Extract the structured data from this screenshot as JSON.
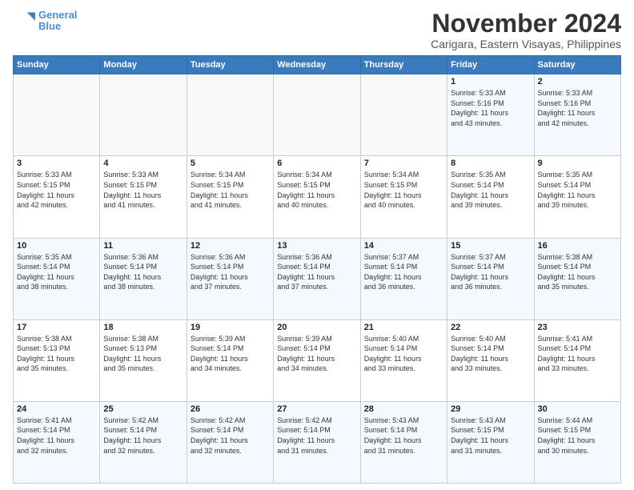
{
  "logo": {
    "line1": "General",
    "line2": "Blue"
  },
  "title": "November 2024",
  "location": "Carigara, Eastern Visayas, Philippines",
  "headers": [
    "Sunday",
    "Monday",
    "Tuesday",
    "Wednesday",
    "Thursday",
    "Friday",
    "Saturday"
  ],
  "weeks": [
    [
      {
        "day": "",
        "info": ""
      },
      {
        "day": "",
        "info": ""
      },
      {
        "day": "",
        "info": ""
      },
      {
        "day": "",
        "info": ""
      },
      {
        "day": "",
        "info": ""
      },
      {
        "day": "1",
        "info": "Sunrise: 5:33 AM\nSunset: 5:16 PM\nDaylight: 11 hours\nand 43 minutes."
      },
      {
        "day": "2",
        "info": "Sunrise: 5:33 AM\nSunset: 5:16 PM\nDaylight: 11 hours\nand 42 minutes."
      }
    ],
    [
      {
        "day": "3",
        "info": "Sunrise: 5:33 AM\nSunset: 5:15 PM\nDaylight: 11 hours\nand 42 minutes."
      },
      {
        "day": "4",
        "info": "Sunrise: 5:33 AM\nSunset: 5:15 PM\nDaylight: 11 hours\nand 41 minutes."
      },
      {
        "day": "5",
        "info": "Sunrise: 5:34 AM\nSunset: 5:15 PM\nDaylight: 11 hours\nand 41 minutes."
      },
      {
        "day": "6",
        "info": "Sunrise: 5:34 AM\nSunset: 5:15 PM\nDaylight: 11 hours\nand 40 minutes."
      },
      {
        "day": "7",
        "info": "Sunrise: 5:34 AM\nSunset: 5:15 PM\nDaylight: 11 hours\nand 40 minutes."
      },
      {
        "day": "8",
        "info": "Sunrise: 5:35 AM\nSunset: 5:14 PM\nDaylight: 11 hours\nand 39 minutes."
      },
      {
        "day": "9",
        "info": "Sunrise: 5:35 AM\nSunset: 5:14 PM\nDaylight: 11 hours\nand 39 minutes."
      }
    ],
    [
      {
        "day": "10",
        "info": "Sunrise: 5:35 AM\nSunset: 5:14 PM\nDaylight: 11 hours\nand 38 minutes."
      },
      {
        "day": "11",
        "info": "Sunrise: 5:36 AM\nSunset: 5:14 PM\nDaylight: 11 hours\nand 38 minutes."
      },
      {
        "day": "12",
        "info": "Sunrise: 5:36 AM\nSunset: 5:14 PM\nDaylight: 11 hours\nand 37 minutes."
      },
      {
        "day": "13",
        "info": "Sunrise: 5:36 AM\nSunset: 5:14 PM\nDaylight: 11 hours\nand 37 minutes."
      },
      {
        "day": "14",
        "info": "Sunrise: 5:37 AM\nSunset: 5:14 PM\nDaylight: 11 hours\nand 36 minutes."
      },
      {
        "day": "15",
        "info": "Sunrise: 5:37 AM\nSunset: 5:14 PM\nDaylight: 11 hours\nand 36 minutes."
      },
      {
        "day": "16",
        "info": "Sunrise: 5:38 AM\nSunset: 5:14 PM\nDaylight: 11 hours\nand 35 minutes."
      }
    ],
    [
      {
        "day": "17",
        "info": "Sunrise: 5:38 AM\nSunset: 5:13 PM\nDaylight: 11 hours\nand 35 minutes."
      },
      {
        "day": "18",
        "info": "Sunrise: 5:38 AM\nSunset: 5:13 PM\nDaylight: 11 hours\nand 35 minutes."
      },
      {
        "day": "19",
        "info": "Sunrise: 5:39 AM\nSunset: 5:14 PM\nDaylight: 11 hours\nand 34 minutes."
      },
      {
        "day": "20",
        "info": "Sunrise: 5:39 AM\nSunset: 5:14 PM\nDaylight: 11 hours\nand 34 minutes."
      },
      {
        "day": "21",
        "info": "Sunrise: 5:40 AM\nSunset: 5:14 PM\nDaylight: 11 hours\nand 33 minutes."
      },
      {
        "day": "22",
        "info": "Sunrise: 5:40 AM\nSunset: 5:14 PM\nDaylight: 11 hours\nand 33 minutes."
      },
      {
        "day": "23",
        "info": "Sunrise: 5:41 AM\nSunset: 5:14 PM\nDaylight: 11 hours\nand 33 minutes."
      }
    ],
    [
      {
        "day": "24",
        "info": "Sunrise: 5:41 AM\nSunset: 5:14 PM\nDaylight: 11 hours\nand 32 minutes."
      },
      {
        "day": "25",
        "info": "Sunrise: 5:42 AM\nSunset: 5:14 PM\nDaylight: 11 hours\nand 32 minutes."
      },
      {
        "day": "26",
        "info": "Sunrise: 5:42 AM\nSunset: 5:14 PM\nDaylight: 11 hours\nand 32 minutes."
      },
      {
        "day": "27",
        "info": "Sunrise: 5:42 AM\nSunset: 5:14 PM\nDaylight: 11 hours\nand 31 minutes."
      },
      {
        "day": "28",
        "info": "Sunrise: 5:43 AM\nSunset: 5:14 PM\nDaylight: 11 hours\nand 31 minutes."
      },
      {
        "day": "29",
        "info": "Sunrise: 5:43 AM\nSunset: 5:15 PM\nDaylight: 11 hours\nand 31 minutes."
      },
      {
        "day": "30",
        "info": "Sunrise: 5:44 AM\nSunset: 5:15 PM\nDaylight: 11 hours\nand 30 minutes."
      }
    ]
  ]
}
